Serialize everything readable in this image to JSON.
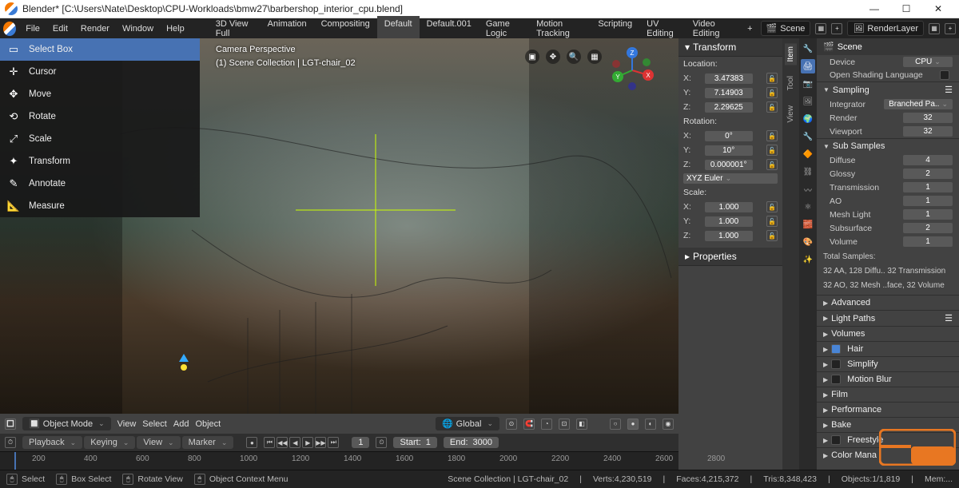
{
  "title": "Blender* [C:\\Users\\Nate\\Desktop\\CPU-Workloads\\bmw27\\barbershop_interior_cpu.blend]",
  "menu": [
    "File",
    "Edit",
    "Render",
    "Window",
    "Help"
  ],
  "workspaces": [
    "3D View Full",
    "Animation",
    "Compositing",
    "Default",
    "Default.001",
    "Game Logic",
    "Motion Tracking",
    "Scripting",
    "UV Editing",
    "Video Editing"
  ],
  "active_workspace": "Default",
  "scene": "Scene",
  "renderlayer": "RenderLayer",
  "tools": [
    {
      "label": "Select Box",
      "icon": "▭"
    },
    {
      "label": "Cursor",
      "icon": "✛"
    },
    {
      "label": "Move",
      "icon": "✥"
    },
    {
      "label": "Rotate",
      "icon": "⟲"
    },
    {
      "label": "Scale",
      "icon": "⤢"
    },
    {
      "label": "Transform",
      "icon": "✦"
    },
    {
      "label": "Annotate",
      "icon": "✎"
    },
    {
      "label": "Measure",
      "icon": "📐"
    }
  ],
  "active_tool": "Select Box",
  "vp_info": {
    "line1": "Camera Perspective",
    "line2": "(1) Scene Collection | LGT-chair_02"
  },
  "vtabs": [
    "Item",
    "Tool",
    "View"
  ],
  "transform": {
    "label": "Transform",
    "location_label": "Location:",
    "rotation_label": "Rotation:",
    "scale_label": "Scale:",
    "rot_mode": "XYZ Euler",
    "loc": {
      "x": "3.47383",
      "y": "7.14903",
      "z": "2.29625"
    },
    "rot": {
      "x": "0°",
      "y": "10°",
      "z": "0.000001°"
    },
    "scale": {
      "x": "1.000",
      "y": "1.000",
      "z": "1.000"
    },
    "properties_label": "Properties"
  },
  "props": {
    "scene": "Scene",
    "device_label": "Device",
    "device": "CPU",
    "osl_label": "Open Shading Language",
    "sampling_label": "Sampling",
    "integrator_label": "Integrator",
    "integrator": "Branched Pa..",
    "render_label": "Render",
    "render_samples": "32",
    "viewport_label": "Viewport",
    "viewport_samples": "32",
    "subsamples_label": "Sub Samples",
    "sub": [
      {
        "label": "Diffuse",
        "val": "4"
      },
      {
        "label": "Glossy",
        "val": "2"
      },
      {
        "label": "Transmission",
        "val": "1"
      },
      {
        "label": "AO",
        "val": "1"
      },
      {
        "label": "Mesh Light",
        "val": "1"
      },
      {
        "label": "Subsurface",
        "val": "2"
      },
      {
        "label": "Volume",
        "val": "1"
      }
    ],
    "totals_label": "Total Samples:",
    "totals1": "32 AA, 128 Diffu.. 32 Transmission",
    "totals2": "32 AO, 32 Mesh ..face, 32 Volume",
    "sections": [
      "Advanced",
      "Light Paths",
      "Volumes",
      "Hair",
      "Simplify",
      "Motion Blur",
      "Film",
      "Performance",
      "Bake",
      "Freestyle",
      "Color Mana"
    ],
    "hair_checked": true
  },
  "vphdr": {
    "mode": "Object Mode",
    "menus": [
      "View",
      "Select",
      "Add",
      "Object"
    ],
    "orientation": "Global"
  },
  "tlhdr": {
    "menus": [
      "Playback",
      "Keying",
      "View",
      "Marker"
    ],
    "frame": "1",
    "start_label": "Start:",
    "start": "1",
    "end_label": "End:",
    "end": "3000"
  },
  "ticks": [
    "200",
    "400",
    "600",
    "800",
    "1000",
    "1200",
    "1400",
    "1600",
    "1800",
    "2000",
    "2200",
    "2400",
    "2600",
    "2800"
  ],
  "status": {
    "select": "Select",
    "box": "Box Select",
    "rotate": "Rotate View",
    "menu": "Object Context Menu",
    "coll": "Scene Collection | LGT-chair_02",
    "verts": "Verts:4,230,519",
    "faces": "Faces:4,215,372",
    "tris": "Tris:8,348,423",
    "objs": "Objects:1/1,819",
    "mem": "Mem:..."
  }
}
